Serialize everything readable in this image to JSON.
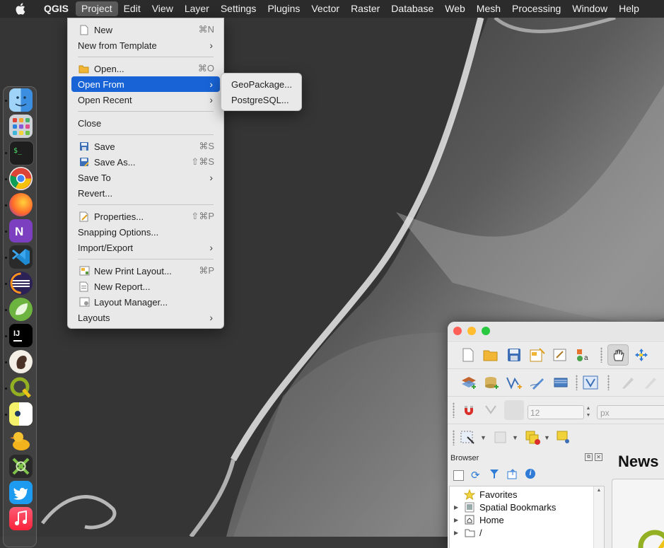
{
  "menubar": {
    "app_name": "QGIS",
    "items": [
      "Project",
      "Edit",
      "View",
      "Layer",
      "Settings",
      "Plugins",
      "Vector",
      "Raster",
      "Database",
      "Web",
      "Mesh",
      "Processing",
      "Window",
      "Help"
    ],
    "active_item": "Project"
  },
  "project_menu": {
    "items": [
      {
        "label": "New",
        "shortcut": "⌘N",
        "icon": "new-project-icon"
      },
      {
        "label": "New from Template",
        "submenu": true
      },
      {
        "label": "Open...",
        "shortcut": "⌘O",
        "icon": "folder-open-icon"
      },
      {
        "label": "Open From",
        "submenu": true,
        "highlighted": true
      },
      {
        "label": "Open Recent",
        "submenu": true
      },
      {
        "label": "Close"
      },
      {
        "label": "Save",
        "shortcut": "⌘S",
        "icon": "save-icon"
      },
      {
        "label": "Save As...",
        "shortcut": "⇧⌘S",
        "icon": "save-as-icon"
      },
      {
        "label": "Save To",
        "submenu": true
      },
      {
        "label": "Revert..."
      },
      {
        "label": "Properties...",
        "shortcut": "⇧⌘P",
        "icon": "properties-icon"
      },
      {
        "label": "Snapping Options..."
      },
      {
        "label": "Import/Export",
        "submenu": true
      },
      {
        "label": "New Print Layout...",
        "shortcut": "⌘P",
        "icon": "print-layout-icon"
      },
      {
        "label": "New Report...",
        "icon": "report-icon"
      },
      {
        "label": "Layout Manager...",
        "icon": "layout-manager-icon"
      },
      {
        "label": "Layouts",
        "submenu": true
      }
    ]
  },
  "open_from_submenu": {
    "items": [
      "GeoPackage...",
      "PostgreSQL..."
    ]
  },
  "dock": {
    "apps": [
      "finder-icon",
      "launchpad-icon",
      "terminal-icon",
      "chrome-icon",
      "firefox-icon",
      "onenote-icon",
      "vscode-icon",
      "eclipse-icon",
      "spring-tools-icon",
      "intellij-icon",
      "squirrel-app-icon",
      "qgis-icon",
      "blue-app-icon",
      "cyberduck-icon",
      "xcode-tool-icon",
      "twitter-icon",
      "music-icon"
    ]
  },
  "qgis_window": {
    "symbology_size_value": "12",
    "symbology_unit": "px",
    "browser_panel_title": "Browser",
    "news_title": "News",
    "browser_items": [
      {
        "label": "Favorites",
        "icon": "star-icon",
        "expandable": false
      },
      {
        "label": "Spatial Bookmarks",
        "icon": "bookmark-icon",
        "expandable": true
      },
      {
        "label": "Home",
        "icon": "home-folder-icon",
        "expandable": true
      },
      {
        "label": "/",
        "icon": "folder-icon",
        "expandable": true
      }
    ]
  },
  "colors": {
    "menu_highlight": "#1864d6",
    "menubar_bg": "#2b2b2b",
    "menu_bg": "#e9e9e9"
  }
}
